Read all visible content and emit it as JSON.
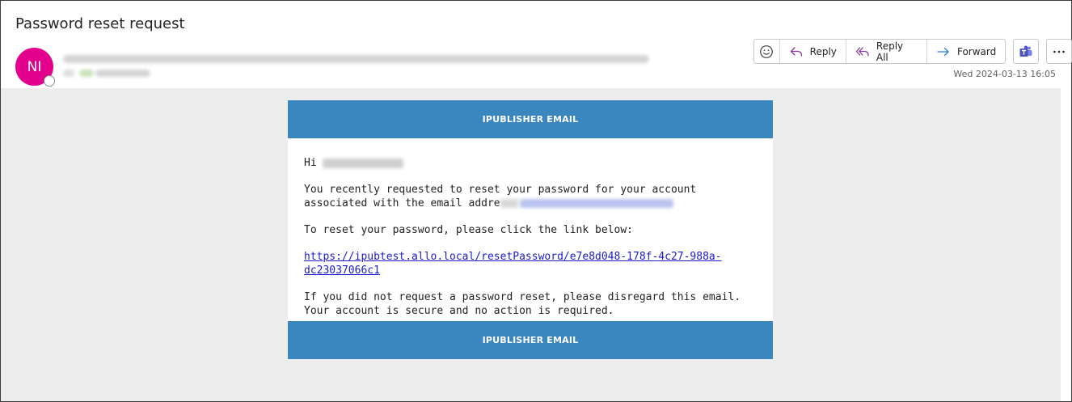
{
  "email": {
    "subject": "Password reset request",
    "avatar_initials": "NI",
    "timestamp": "Wed 2024-03-13 16:05"
  },
  "toolbar": {
    "reply_label": "Reply",
    "reply_all_label": "Reply All",
    "forward_label": "Forward"
  },
  "message": {
    "banner_top": "IPUBLISHER EMAIL",
    "greeting": "Hi",
    "para1_part1": "You recently requested to reset your password for your account associated with the email addre",
    "para2": "To reset your password, please click the link below:",
    "reset_link": "https://ipubtest.allo.local/resetPassword/e7e8d048-178f-4c27-988a-dc23037066c1",
    "para3": "If you did not request a password reset, please disregard this email. Your account is secure and no action is required.",
    "banner_bottom": "IPUBLISHER EMAIL"
  },
  "colors": {
    "avatar": "#e3008c",
    "banner": "#3a86bf",
    "link": "#1a1acc",
    "reply_icon": "#8a3c9e",
    "forward_icon": "#2b7cd3",
    "teams": "#4b53bc"
  }
}
